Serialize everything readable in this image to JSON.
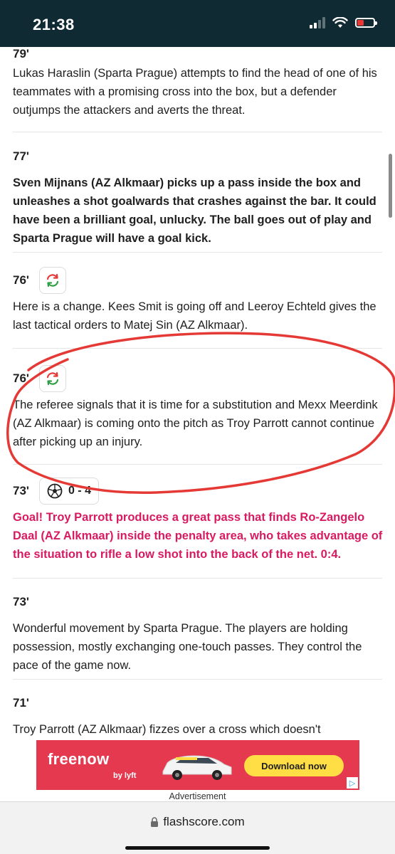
{
  "status": {
    "time": "21:38"
  },
  "feed": [
    {
      "minute": "79'",
      "text": "Lukas Haraslin (Sparta Prague) attempts to find the head of one of his teammates with a promising cross into the box, but a defender outjumps the attackers and averts the threat.",
      "style": "normal"
    },
    {
      "minute": "77'",
      "text": "Sven Mijnans (AZ Alkmaar) picks up a pass inside the box and unleashes a shot goalwards that crashes against the bar. It could have been a brilliant goal, unlucky. The ball goes out of play and Sparta Prague will have a goal kick.",
      "style": "bold"
    },
    {
      "minute": "76'",
      "icon": "substitution-icon",
      "text": "Here is a change. Kees Smit is going off and Leeroy Echteld gives the last tactical orders to Matej Sin (AZ Alkmaar).",
      "style": "normal"
    },
    {
      "minute": "76'",
      "icon": "substitution-icon",
      "text": "The referee signals that it is time for a substitution and Mexx Meerdink (AZ Alkmaar) is coming onto the pitch as Troy Parrott cannot continue after picking up an injury.",
      "style": "normal"
    },
    {
      "minute": "73'",
      "icon": "ball-icon",
      "score": "0 - 4",
      "text": "Goal! Troy Parrott produces a great pass that finds Ro-Zangelo Daal (AZ Alkmaar) inside the penalty area, who takes advantage of the situation to rifle a low shot into the back of the net. 0:4.",
      "style": "goal"
    },
    {
      "minute": "73'",
      "text": "Wonderful movement by Sparta Prague. The players are holding possession, mostly exchanging one-touch passes. They control the pace of the game now.",
      "style": "normal"
    },
    {
      "minute": "71'",
      "text": "Troy Parrott (AZ Alkmaar) fizzes over a cross which doesn't",
      "style": "normal"
    }
  ],
  "ad": {
    "brand": "freenow",
    "by": "by lyft",
    "button": "Download now",
    "label": "Advertisement",
    "color": "#e53950"
  },
  "browser": {
    "url": "flashscore.com"
  },
  "colors": {
    "goal_text": "#d81b60",
    "status_bar": "#0f2a33",
    "annotation": "#e53935"
  }
}
